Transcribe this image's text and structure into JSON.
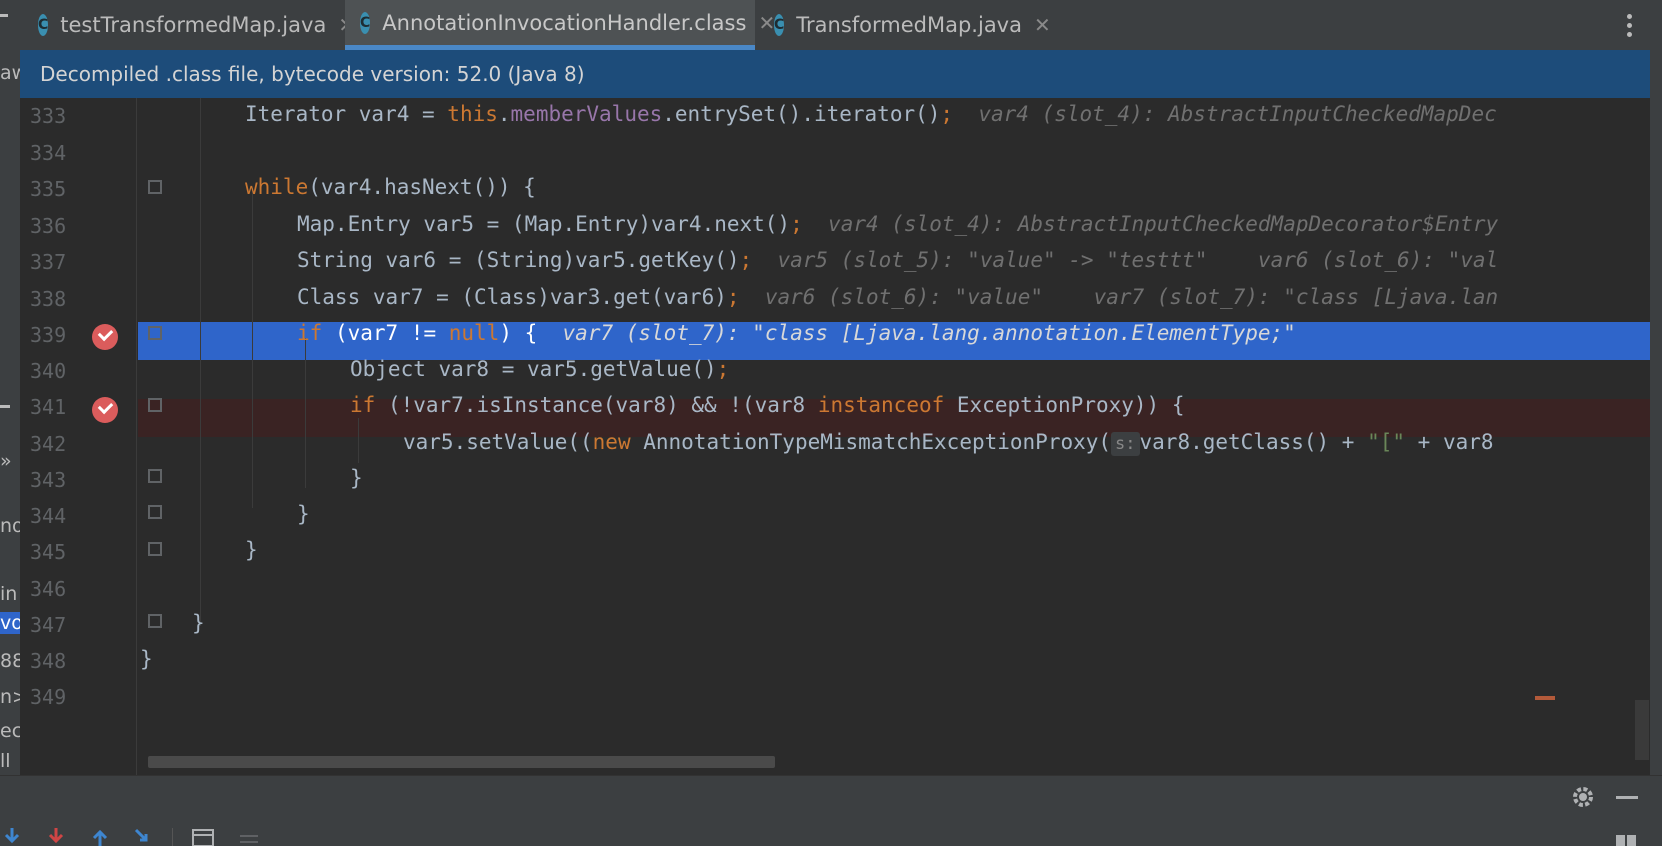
{
  "tabs": [
    {
      "label": "testTransformedMap.java",
      "icon": "c-class-icon"
    },
    {
      "label": "AnnotationInvocationHandler.class",
      "icon": "c-class-icon"
    },
    {
      "label": "TransformedMap.java",
      "icon": "c-class-icon"
    }
  ],
  "tab_close_glyph": "✕",
  "tab_icon_letter": "C",
  "banner": "Decompiled .class file, bytecode version: 52.0 (Java 8)",
  "left_panel_fragments": [
    "aw",
    "»",
    "no",
    "in",
    "voi",
    "88",
    "n>",
    "ec",
    "ll"
  ],
  "line_numbers": [
    "333",
    "334",
    "335",
    "336",
    "337",
    "338",
    "339",
    "340",
    "341",
    "342",
    "343",
    "344",
    "345",
    "346",
    "347",
    "348",
    "349"
  ],
  "code": {
    "l333_hint": "var4 (slot_4): AbstractInputCheckedMapDec",
    "l336_hint": "var4 (slot_4): AbstractInputCheckedMapDecorator$Entry",
    "l337_hint1": "var5 (slot_5): \"value\" -> \"testtt\"",
    "l337_hint2": "var6 (slot_6): \"val",
    "l338_hint1": "var6 (slot_6): \"value\"",
    "l338_hint2": "var7 (slot_7): \"class [Ljava.lan",
    "l339_hint": "var7 (slot_7): \"class [Ljava.lang.annotation.ElementType;\"",
    "l342_param_hint": "s:"
  },
  "colors": {
    "accent": "#4a88c7",
    "banner": "#1d4c7a",
    "current_line": "#2f65ca",
    "breakpoint_line": "#3a2323",
    "breakpoint": "#db5c5c"
  }
}
